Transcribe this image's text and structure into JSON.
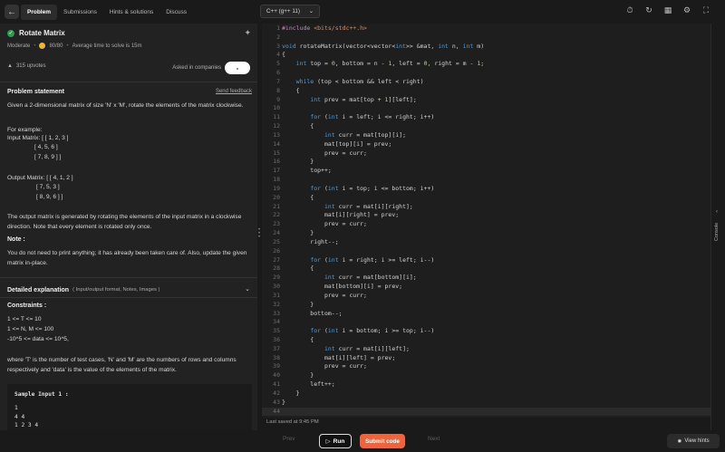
{
  "topbar": {
    "tabs": [
      {
        "label": "Problem",
        "active": true
      },
      {
        "label": "Submissions",
        "active": false
      },
      {
        "label": "Hints & solutions",
        "active": false
      },
      {
        "label": "Discuss",
        "active": false
      }
    ],
    "language": "C++ (g++ 11)",
    "icons": [
      "timer-icon",
      "refresh-icon",
      "layout-icon",
      "settings-icon",
      "fullscreen-icon"
    ]
  },
  "problem": {
    "title": "Rotate Matrix",
    "difficulty": "Moderate",
    "score": "80/80",
    "avg_time": "Average time to solve is 15m",
    "upvotes": "315 upvotes",
    "asked_in": "Asked in companies",
    "statement_title": "Problem statement",
    "send_feedback": "Send feedback",
    "statement": "Given a 2-dimensional matrix of size 'N' x 'M', rotate the elements of the matrix clockwise.",
    "for_example": "For example:",
    "input_label": "Input Matrix: [ [ 1, 2, 3 ]",
    "input_rows": [
      "[ 4, 5, 6 ]",
      "[ 7, 8, 9 ] ]"
    ],
    "output_label": "Output Matrix: [ [ 4, 1, 2 ]",
    "output_rows": [
      "[ 7, 5, 3 ]",
      "[ 8, 9, 6 ] ]"
    ],
    "explanation": "The output matrix is generated by rotating the elements of the input matrix in a clockwise direction. Note that every element is rotated only once.",
    "note_title": "Note :",
    "note": "You do not need to print anything; it has already been taken care of. Also, update the given matrix in-place.",
    "detailed_title": "Detailed explanation",
    "detailed_sub": "( Input/output format, Notes, Images )",
    "constraints_title": "Constraints :",
    "constraints": [
      "1 <= T <= 10",
      "1 <= N, M <= 100",
      "-10^5 <= data <= 10^5,"
    ],
    "constraints_note": "where 'T' is the number of test cases,  'N' and 'M' are the numbers of rows and columns respectively and 'data' is the value of the elements of the matrix.",
    "sample_title": "Sample Input 1 :",
    "sample_lines": [
      "1",
      "4 4",
      "1 2 3 4"
    ]
  },
  "editor": {
    "last_saved": "Last saved at 9:45 PM",
    "console_label": "Console"
  },
  "bottom": {
    "prev": "Prev",
    "run": "Run",
    "submit": "Submit code",
    "next": "Next",
    "view_hints": "View hints"
  },
  "colors": {
    "accent": "#f0643c",
    "success": "#2e9b4f",
    "keyword": "#569cd6",
    "string": "#ce9178"
  }
}
